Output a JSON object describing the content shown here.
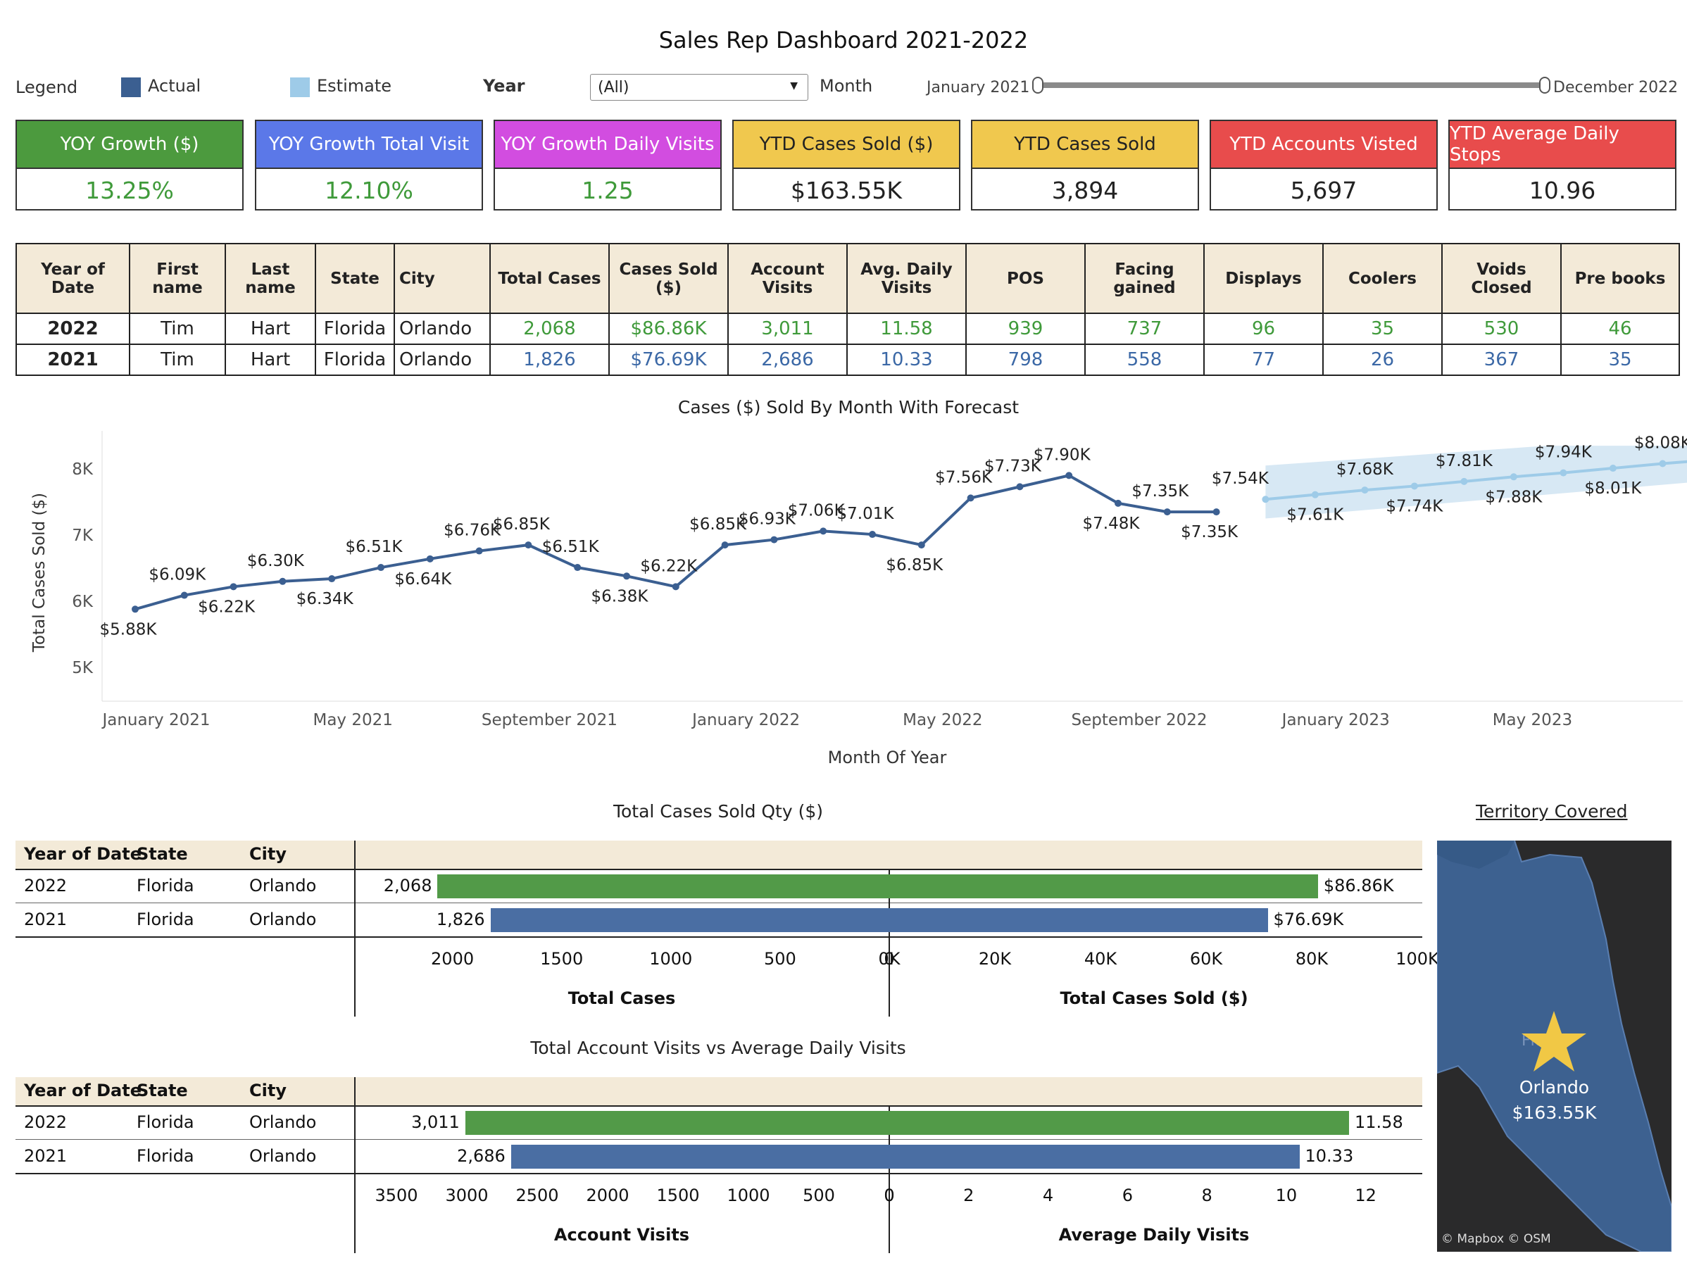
{
  "title": "Sales Rep Dashboard 2021-2022",
  "legend": {
    "label": "Legend",
    "actual": "Actual",
    "estimate": "Estimate",
    "actual_color": "#3b5f91",
    "estimate_color": "#9ecbe8"
  },
  "filters": {
    "year_label": "Year",
    "year_value": "(All)",
    "month_label": "Month",
    "month_start": "January 2021",
    "month_end": "December 2022"
  },
  "kpis": [
    {
      "label": "YOY Growth ($)",
      "value": "13.25%",
      "bg": "#4c9a3e",
      "fg": "#ffffff",
      "vcolor": "#3f9a3a"
    },
    {
      "label": "YOY Growth Total Visit",
      "value": "12.10%",
      "bg": "#5b78e8",
      "fg": "#ffffff",
      "vcolor": "#3f9a3a"
    },
    {
      "label": "YOY Growth Daily Visits",
      "value": "1.25",
      "bg": "#d24de0",
      "fg": "#ffffff",
      "vcolor": "#3f9a3a"
    },
    {
      "label": "YTD Cases Sold ($)",
      "value": "$163.55K",
      "bg": "#f0c84e",
      "fg": "#222222",
      "vcolor": "#222222"
    },
    {
      "label": "YTD  Cases Sold",
      "value": "3,894",
      "bg": "#f0c84e",
      "fg": "#222222",
      "vcolor": "#222222"
    },
    {
      "label": "YTD Accounts Visted",
      "value": "5,697",
      "bg": "#e84c4c",
      "fg": "#ffffff",
      "vcolor": "#222222"
    },
    {
      "label": "YTD Average Daily Stops",
      "value": "10.96",
      "bg": "#e84c4c",
      "fg": "#ffffff",
      "vcolor": "#222222"
    }
  ],
  "summary_table": {
    "headers": [
      "Year of Date",
      "First name",
      "Last name",
      "State",
      "City",
      "Total Cases",
      "Cases Sold ($)",
      "Account Visits",
      "Avg. Daily Visits",
      "POS",
      "Facing gained",
      "Displays",
      "Coolers",
      "Voids Closed",
      "Pre books"
    ],
    "rows": [
      [
        "2022",
        "Tim",
        "Hart",
        "Florida",
        "Orlando",
        "2,068",
        "$86.86K",
        "3,011",
        "11.58",
        "939",
        "737",
        "96",
        "35",
        "530",
        "46"
      ],
      [
        "2021",
        "Tim",
        "Hart",
        "Florida",
        "Orlando",
        "1,826",
        "$76.69K",
        "2,686",
        "10.33",
        "798",
        "558",
        "77",
        "26",
        "367",
        "35"
      ]
    ]
  },
  "line_chart": {
    "title": "Cases ($) Sold By Month With Forecast",
    "xlabel": "Month Of Year",
    "ylabel": "Total Cases Sold ($)",
    "yticks": [
      "8K",
      "7K",
      "6K",
      "5K"
    ],
    "xticks": [
      "January 2021",
      "May 2021",
      "September 2021",
      "January 2022",
      "May 2022",
      "September 2022",
      "January 2023",
      "May 2023"
    ]
  },
  "chart_data": [
    {
      "type": "line",
      "title": "Cases ($) Sold By Month With Forecast",
      "xlabel": "Month Of Year",
      "ylabel": "Total Cases Sold ($)",
      "ylim": [
        4.7,
        8.4
      ],
      "series": [
        {
          "name": "Actual",
          "x": [
            "2021-01",
            "2021-02",
            "2021-03",
            "2021-04",
            "2021-05",
            "2021-06",
            "2021-07",
            "2021-08",
            "2021-09",
            "2021-10",
            "2021-11",
            "2021-12",
            "2022-01",
            "2022-02",
            "2022-03",
            "2022-04",
            "2022-05",
            "2022-06",
            "2022-07",
            "2022-08",
            "2022-09",
            "2022-10",
            "2022-11",
            "2022-12"
          ],
          "values": [
            5.88,
            6.09,
            6.22,
            6.3,
            6.34,
            6.51,
            6.64,
            6.76,
            6.85,
            6.51,
            6.38,
            6.22,
            6.85,
            6.93,
            7.06,
            7.01,
            6.85,
            7.56,
            7.73,
            7.9,
            7.48,
            7.35,
            7.35,
            null
          ],
          "labels": [
            "$5.88K",
            "$6.09K",
            "$6.22K",
            "$6.30K",
            "$6.34K",
            "$6.51K",
            "$6.64K",
            "$6.76K",
            "$6.85K",
            "$6.51K",
            "$6.38K",
            "$6.22K",
            "$6.85K",
            "$6.93K",
            "$7.06K",
            "$7.01K",
            "$6.85K",
            "$7.56K",
            "$7.73K",
            "$7.90K",
            "$7.48K",
            "$7.35K",
            "$7.35K",
            ""
          ]
        },
        {
          "name": "Estimate",
          "x": [
            "2022-12",
            "2023-01",
            "2023-02",
            "2023-03",
            "2023-04",
            "2023-05",
            "2023-06",
            "2023-07",
            "2023-08",
            "2023-09"
          ],
          "values": [
            7.54,
            7.61,
            7.68,
            7.74,
            7.81,
            7.88,
            7.94,
            8.01,
            8.08,
            8.14
          ],
          "labels": [
            "$7.54K",
            "$7.61K",
            "$7.68K",
            "$7.74K",
            "$7.81K",
            "$7.88K",
            "$7.94K",
            "$8.01K",
            "$8.08K",
            ""
          ]
        }
      ]
    },
    {
      "type": "bar",
      "title": "Total Cases Sold Qty ($)",
      "categories": [
        "2022",
        "2021"
      ],
      "series": [
        {
          "name": "Total Cases",
          "values": [
            2068,
            1826
          ],
          "labels": [
            "2,068",
            "1,826"
          ]
        },
        {
          "name": "Total Cases Sold ($)",
          "values": [
            86.86,
            76.69
          ],
          "labels": [
            "$86.86K",
            "$76.69K"
          ]
        }
      ],
      "left_ticks": [
        "2000",
        "1500",
        "1000",
        "500",
        "0"
      ],
      "right_ticks": [
        "0K",
        "20K",
        "40K",
        "60K",
        "80K",
        "100K"
      ]
    },
    {
      "type": "bar",
      "title": "Total Account Visits vs Average Daily Visits",
      "categories": [
        "2022",
        "2021"
      ],
      "series": [
        {
          "name": "Account Visits",
          "values": [
            3011,
            2686
          ],
          "labels": [
            "3,011",
            "2,686"
          ]
        },
        {
          "name": "Average Daily Visits",
          "values": [
            11.58,
            10.33
          ],
          "labels": [
            "11.58",
            "10.33"
          ]
        }
      ],
      "left_ticks": [
        "3500",
        "3000",
        "2500",
        "2000",
        "1500",
        "1000",
        "500",
        "0"
      ],
      "right_ticks": [
        "0",
        "2",
        "4",
        "6",
        "8",
        "10",
        "12"
      ]
    }
  ],
  "bar1": {
    "title": "Total Cases Sold Qty ($)",
    "headers": [
      "Year of Date",
      "State",
      "City"
    ],
    "rows": [
      [
        "2022",
        "Florida",
        "Orlando"
      ],
      [
        "2021",
        "Florida",
        "Orlando"
      ]
    ],
    "left_axis_title": "Total Cases",
    "right_axis_title": "Total Cases Sold ($)"
  },
  "bar2": {
    "title": "Total Account Visits vs Average Daily Visits",
    "headers": [
      "Year of Date",
      "State",
      "City"
    ],
    "rows": [
      [
        "2022",
        "Florida",
        "Orlando"
      ],
      [
        "2021",
        "Florida",
        "Orlando"
      ]
    ],
    "left_axis_title": "Account Visits",
    "right_axis_title": "Average Daily Visits"
  },
  "map": {
    "title": "Territory Covered",
    "state_label": "Flo",
    "city": "Orlando",
    "value": "$163.55K",
    "credits": "© Mapbox  © OSM",
    "star_color": "#f1c845"
  }
}
